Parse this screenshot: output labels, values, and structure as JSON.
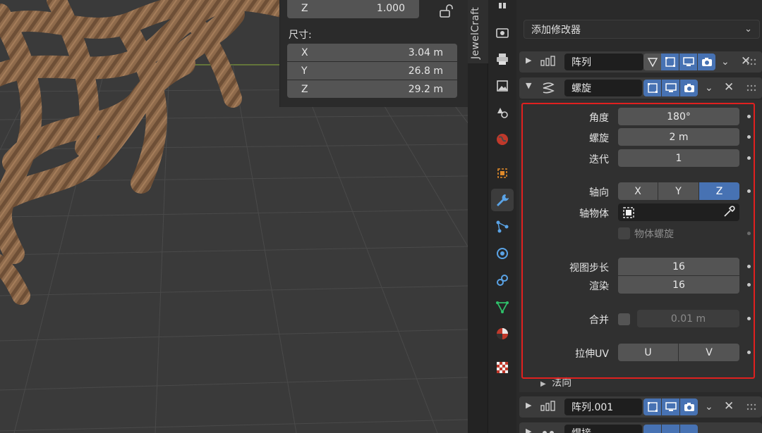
{
  "npanel": {
    "rot_z": {
      "axis": "Z",
      "value": "1.000"
    },
    "dimensions_label": "尺寸:",
    "dimensions": [
      {
        "axis": "X",
        "value": "3.04 m"
      },
      {
        "axis": "Y",
        "value": "26.8 m"
      },
      {
        "axis": "Z",
        "value": "29.2 m"
      }
    ]
  },
  "side_tab": {
    "label": "JewelCraft"
  },
  "properties": {
    "add_modifier": "添加修改器",
    "modifiers": [
      {
        "name": "阵列",
        "expanded": false,
        "type_icon": "array-icon"
      },
      {
        "name": "螺旋",
        "expanded": true,
        "type_icon": "screw-icon"
      },
      {
        "name": "阵列.001",
        "expanded": false,
        "type_icon": "array-icon"
      },
      {
        "name": "焊接",
        "expanded": false,
        "type_icon": "weld-icon"
      }
    ],
    "screw": {
      "angle_label": "角度",
      "angle": "180°",
      "screw_label": "螺旋",
      "screw": "2 m",
      "iterations_label": "迭代",
      "iterations": "1",
      "axis_label": "轴向",
      "axis_options": [
        "X",
        "Y",
        "Z"
      ],
      "axis_selected": "Z",
      "axis_object_label": "轴物体",
      "object_screw_label": "物体螺旋",
      "viewport_steps_label": "视图步长",
      "viewport_steps": "16",
      "render_label": "渲染",
      "render_steps": "16",
      "merge_label": "合并",
      "merge_value": "0.01 m",
      "stretch_uv_label": "拉伸UV",
      "uv_options": [
        "U",
        "V"
      ],
      "normals_label": "法向"
    }
  },
  "colors": {
    "accent": "#4772b3",
    "highlight_box": "#e0201f",
    "rope": "#8a6546"
  }
}
